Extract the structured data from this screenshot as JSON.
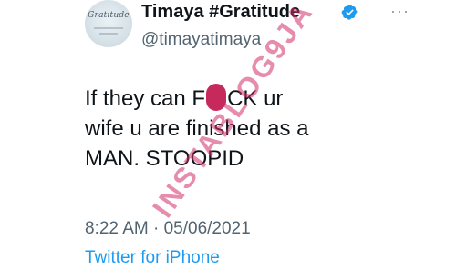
{
  "tweet": {
    "avatar_text": "Gratitude",
    "display_name": "Timaya #Gratitude",
    "handle": "@timayatimaya",
    "verified_icon": "verified-badge-icon",
    "more_icon": "more-options-icon",
    "more_label": "···",
    "text_before": "If  they can F",
    "text_after": "CK ur\nwife u are finished as a\nMAN. STOOPID",
    "timestamp": "8:22 AM · 05/06/2021",
    "source": "Twitter for iPhone"
  },
  "watermark": "INSTABLOG9JA",
  "colors": {
    "name": "#0f1419",
    "secondary": "#536471",
    "link": "#1d9bf0",
    "verified": "#1d9bf0",
    "censor": "#c62a5c",
    "watermark": "#d12e68"
  }
}
